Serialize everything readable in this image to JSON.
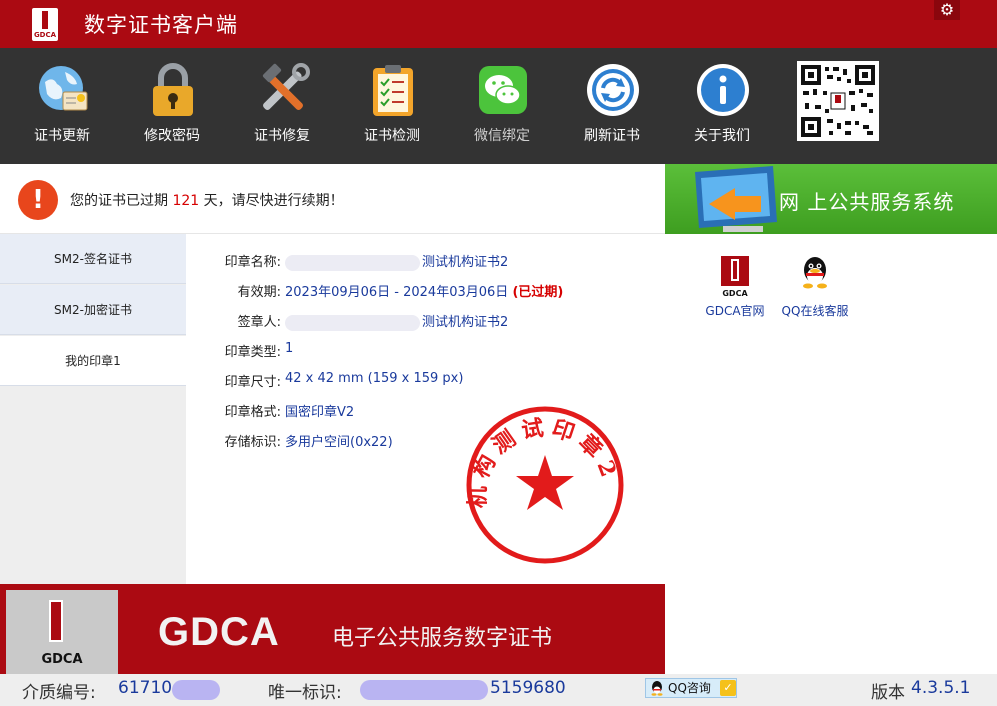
{
  "app": {
    "title": "数字证书客户端",
    "logo_text": "GDCA",
    "settings_icon": "gear-icon"
  },
  "toolbar": {
    "items": [
      {
        "label": "证书更新",
        "icon": "globe-certificate-icon"
      },
      {
        "label": "修改密码",
        "icon": "padlock-icon"
      },
      {
        "label": "证书修复",
        "icon": "wrench-hammer-icon"
      },
      {
        "label": "证书检测",
        "icon": "clipboard-checklist-icon"
      },
      {
        "label": "微信绑定",
        "icon": "wechat-icon"
      },
      {
        "label": "刷新证书",
        "icon": "refresh-icon"
      },
      {
        "label": "关于我们",
        "icon": "info-icon"
      }
    ],
    "qr_icon": "qr-code-icon"
  },
  "alert": {
    "prefix": "您的证书已过期",
    "days": "121",
    "suffix": "天，请尽快进行续期！",
    "icon": "exclamation-icon"
  },
  "banner": {
    "title": "网 上公共服务系统"
  },
  "sidebar": {
    "items": [
      {
        "label": "SM2-签名证书",
        "active": false
      },
      {
        "label": "SM2-加密证书",
        "active": false
      },
      {
        "label": "我的印章1",
        "active": true
      }
    ]
  },
  "seal": {
    "name_label": "印章名称:",
    "name_value": "测试机构证书2",
    "validity_label": "有效期:",
    "validity_value": "2023年09月06日 - 2024年03月06日",
    "validity_status": "(已过期)",
    "signer_label": "签章人:",
    "signer_value": "测试机构证书2",
    "type_label": "印章类型:",
    "type_value": "1",
    "size_label": "印章尺寸:",
    "size_value": "42 x 42 mm (159 x 159 px)",
    "format_label": "印章格式:",
    "format_value": "国密印章V2",
    "storage_label": "存储标识:",
    "storage_value": "多用户空间(0x22)",
    "stamp_text": "机构测试印章2"
  },
  "right_links": [
    {
      "label": "GDCA官网",
      "icon": "gdca-logo-icon"
    },
    {
      "label": "QQ在线客服",
      "icon": "qq-penguin-icon"
    }
  ],
  "bottom_banner": {
    "logo_text": "GDCA",
    "big_text": "GDCA",
    "sub_text": "电子公共服务数字证书"
  },
  "status": {
    "media_label": "介质编号:",
    "media_value": "61710",
    "uid_label": "唯一标识:",
    "uid_value": "5159680",
    "qq_btn": "QQ咨询",
    "version_label": "版本",
    "version_value": "4.3.5.1"
  },
  "colors": {
    "brand_red": "#ab0a12",
    "toolbar_bg": "#333333",
    "link_blue": "#1a3a9c",
    "alert_red": "#d60000",
    "banner_green": "#4cae2d"
  }
}
